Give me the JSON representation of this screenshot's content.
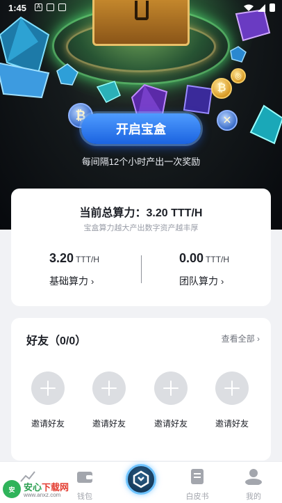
{
  "status_bar": {
    "time": "1:45",
    "icon_a": "A"
  },
  "hero": {
    "open_button": "开启宝盒",
    "note": "每间隔12个小时产出一次奖励"
  },
  "power": {
    "title": "当前总算力：3.20 TTT/H",
    "subtitle": "宝盒算力越大产出数字资产越丰厚",
    "base": {
      "value": "3.20",
      "unit": "TTT/H",
      "label": "基础算力"
    },
    "team": {
      "value": "0.00",
      "unit": "TTT/H",
      "label": "团队算力"
    }
  },
  "friends": {
    "title": "好友（0/0）",
    "view_all": "查看全部",
    "invite_label": "邀请好友",
    "slots": [
      {
        "label": "邀请好友"
      },
      {
        "label": "邀请好友"
      },
      {
        "label": "邀请好友"
      },
      {
        "label": "邀请好友"
      }
    ]
  },
  "nav": {
    "items": [
      {
        "label": "",
        "icon": "chart-icon"
      },
      {
        "label": "钱包",
        "icon": "wallet-icon"
      },
      {
        "label": "",
        "icon": "hub-icon"
      },
      {
        "label": "白皮书",
        "icon": "document-icon"
      },
      {
        "label": "我的",
        "icon": "profile-icon"
      }
    ]
  },
  "watermark": {
    "brand_a": "安心",
    "brand_b": "下载网",
    "url": "www.anxz.com",
    "logo_text": "安"
  }
}
